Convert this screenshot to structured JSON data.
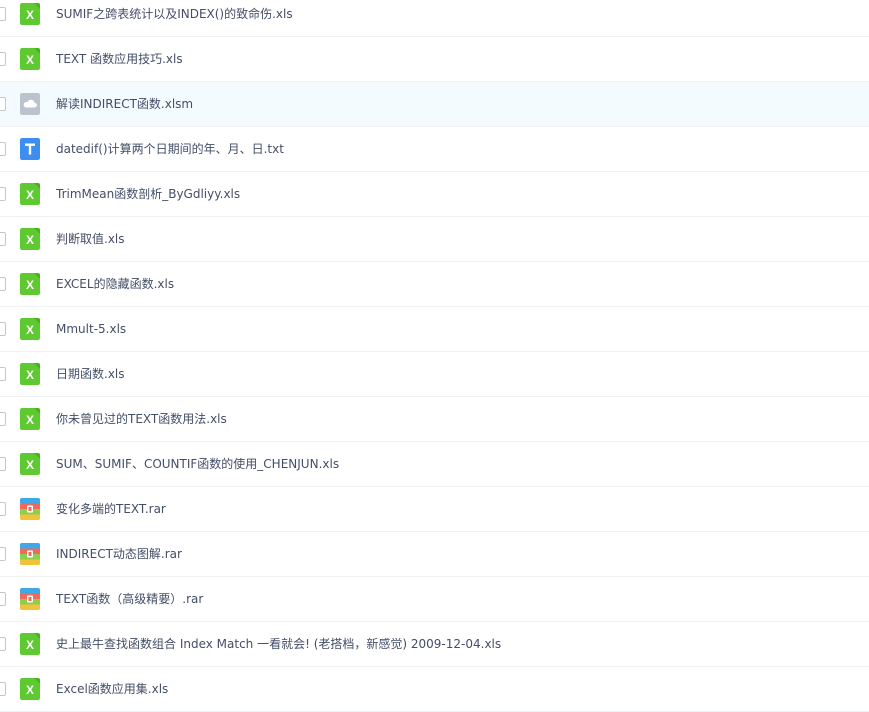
{
  "files": [
    {
      "name": "SUMIF之跨表统计以及INDEX()的致命伤.xls",
      "type": "excel",
      "icon": "excel-file-icon",
      "selected": false
    },
    {
      "name": "TEXT 函数应用技巧.xls",
      "type": "excel",
      "icon": "excel-file-icon",
      "selected": false
    },
    {
      "name": "解读INDIRECT函数.xlsm",
      "type": "cloud",
      "icon": "cloud-file-icon",
      "selected": true
    },
    {
      "name": "datedif()计算两个日期间的年、月、日.txt",
      "type": "text",
      "icon": "text-file-icon",
      "selected": false
    },
    {
      "name": "TrimMean函数剖析_ByGdliyy.xls",
      "type": "excel",
      "icon": "excel-file-icon",
      "selected": false
    },
    {
      "name": "判断取值.xls",
      "type": "excel",
      "icon": "excel-file-icon",
      "selected": false
    },
    {
      "name": "EXCEL的隐藏函数.xls",
      "type": "excel",
      "icon": "excel-file-icon",
      "selected": false
    },
    {
      "name": "Mmult-5.xls",
      "type": "excel",
      "icon": "excel-file-icon",
      "selected": false
    },
    {
      "name": "日期函数.xls",
      "type": "excel",
      "icon": "excel-file-icon",
      "selected": false
    },
    {
      "name": "你未曾见过的TEXT函数用法.xls",
      "type": "excel",
      "icon": "excel-file-icon",
      "selected": false
    },
    {
      "name": "SUM、SUMIF、COUNTIF函数的使用_CHENJUN.xls",
      "type": "excel",
      "icon": "excel-file-icon",
      "selected": false
    },
    {
      "name": "变化多端的TEXT.rar",
      "type": "archive",
      "icon": "archive-file-icon",
      "selected": false
    },
    {
      "name": "INDIRECT动态图解.rar",
      "type": "archive",
      "icon": "archive-file-icon",
      "selected": false
    },
    {
      "name": "TEXT函数（高级精要）.rar",
      "type": "archive",
      "icon": "archive-file-icon",
      "selected": false
    },
    {
      "name": "史上最牛查找函数组合 Index Match 一看就会! (老搭档，新感觉) 2009-12-04.xls",
      "type": "excel",
      "icon": "excel-file-icon",
      "selected": false
    },
    {
      "name": "Excel函数应用集.xls",
      "type": "excel",
      "icon": "excel-file-icon",
      "selected": false
    }
  ],
  "colors": {
    "excel": "#5fc932",
    "cloud": "#bcc3cc",
    "text": "#3e8ef0",
    "row_border": "#f1f2f4",
    "selected_bg": "#f4fbfe",
    "text_color": "#424e67"
  }
}
